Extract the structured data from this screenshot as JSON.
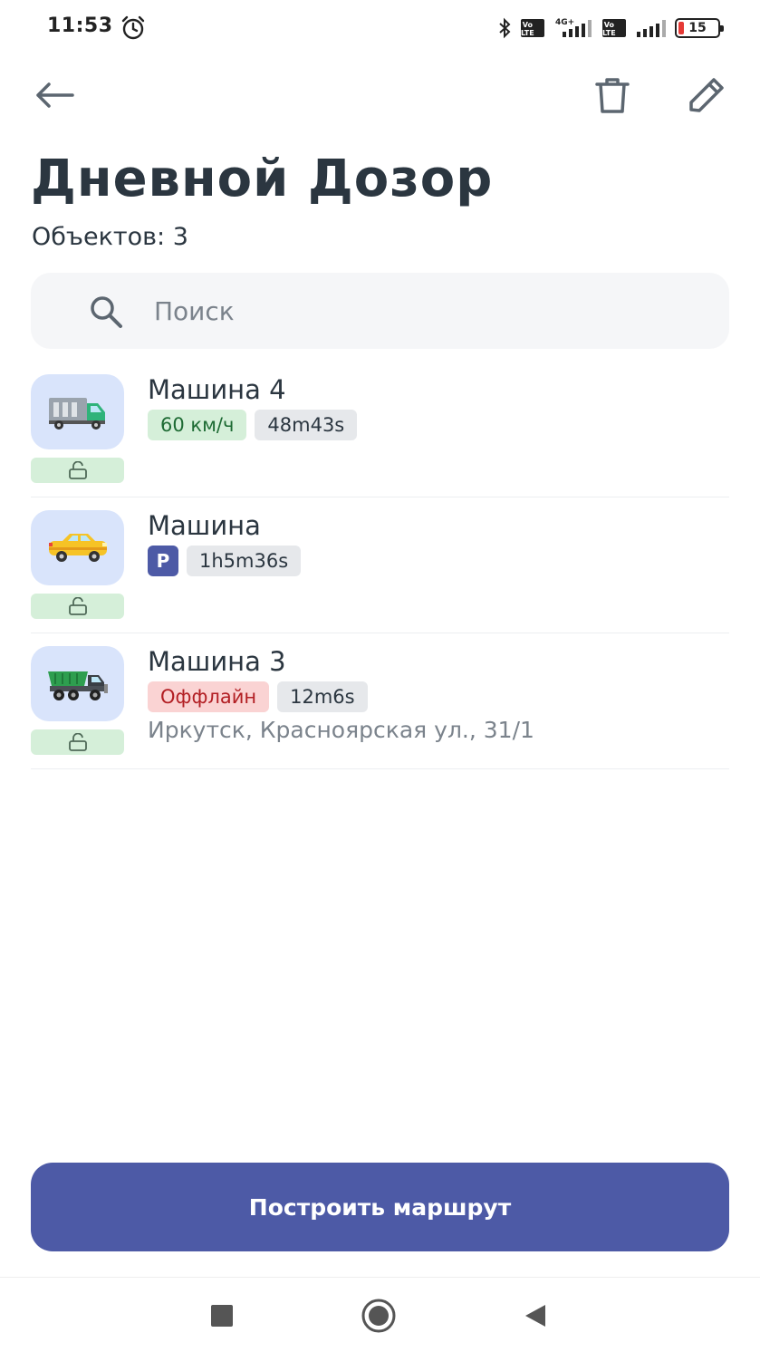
{
  "status_bar": {
    "time": "11:53",
    "network_label": "4G+",
    "volte_label": "Vo\nLTE",
    "battery_level": "15",
    "battery_fraction": 0.15,
    "icons": [
      "alarm-icon",
      "bluetooth-icon",
      "volte-icon",
      "signal-icon",
      "battery-icon"
    ]
  },
  "app_bar": {
    "icons": [
      "arrow-left-icon",
      "trash-icon",
      "pencil-icon"
    ]
  },
  "header": {
    "title": "Дневной Дозор",
    "object_count": "Объектов: 3"
  },
  "search": {
    "placeholder": "Поиск",
    "value": ""
  },
  "vehicles": [
    {
      "name": "Машина 4",
      "icon": "truck-icon",
      "status_chip": "60 км/ч",
      "status_type": "speed",
      "duration": "48m43s",
      "address": ""
    },
    {
      "name": "Машина",
      "icon": "taxi-car-icon",
      "status_chip": "P",
      "status_type": "parking",
      "duration": "1h5m36s",
      "address": ""
    },
    {
      "name": "Машина 3",
      "icon": "dump-truck-icon",
      "status_chip": "Оффлайн",
      "status_type": "offline",
      "duration": "12m6s",
      "address": "Иркутск, Красноярская ул., 31/1"
    }
  ],
  "actions": {
    "route_button": "Построить маршрут"
  },
  "colors": {
    "primary": "#4d5aa6",
    "text": "#2b3640",
    "speed_chip_bg": "#d5efd9",
    "offline_chip_bg": "#fad3d3",
    "avatar_bg": "#d9e4fb"
  }
}
